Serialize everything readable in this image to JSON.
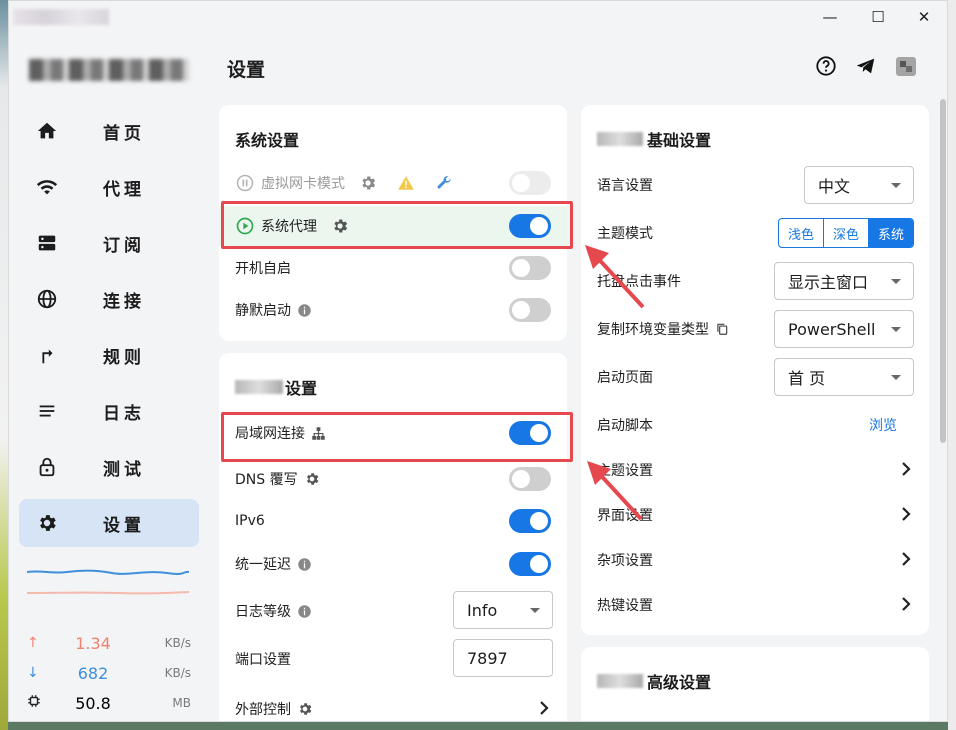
{
  "window": {
    "controls": {
      "minimize": "—",
      "maximize": "☐",
      "close": "✕"
    }
  },
  "sidebar": {
    "items": [
      {
        "label": "首页",
        "icon": "home-icon",
        "active": false
      },
      {
        "label": "代理",
        "icon": "wifi-icon",
        "active": false
      },
      {
        "label": "订阅",
        "icon": "storage-icon",
        "active": false
      },
      {
        "label": "连接",
        "icon": "globe-icon",
        "active": false
      },
      {
        "label": "规则",
        "icon": "route-icon",
        "active": false
      },
      {
        "label": "日志",
        "icon": "list-icon",
        "active": false
      },
      {
        "label": "测试",
        "icon": "lock-icon",
        "active": false
      },
      {
        "label": "设置",
        "icon": "gear-icon",
        "active": true
      }
    ],
    "stats": {
      "upload": {
        "arrow": "↑",
        "value": "1.34",
        "unit": "KB/s",
        "color": "#f0826f"
      },
      "download": {
        "arrow": "↓",
        "value": "682",
        "unit": "KB/s",
        "color": "#3f8fdc"
      },
      "memory": {
        "value": "50.8",
        "unit": "MB"
      }
    }
  },
  "header": {
    "title": "设置",
    "icons": [
      "help-icon",
      "telegram-icon",
      "github-icon"
    ]
  },
  "system_card": {
    "title": "系统设置",
    "rows": [
      {
        "label": "虚拟网卡模式",
        "toggle": "disabled"
      },
      {
        "label": "系统代理",
        "toggle": "on"
      },
      {
        "label": "开机自启",
        "toggle": "off"
      },
      {
        "label": "静默启动",
        "toggle": "off"
      }
    ]
  },
  "clash_card": {
    "title_suffix": "设置",
    "rows": [
      {
        "label": "局域网连接",
        "toggle": "on"
      },
      {
        "label": "DNS 覆写",
        "toggle": "off"
      },
      {
        "label": "IPv6",
        "toggle": "on"
      },
      {
        "label": "统一延迟",
        "toggle": "on"
      },
      {
        "label": "日志等级",
        "select": "Info"
      },
      {
        "label": "端口设置",
        "input": "7897"
      },
      {
        "label": "外部控制"
      }
    ]
  },
  "basic_card": {
    "title_suffix": "基础设置",
    "rows": [
      {
        "label": "语言设置",
        "select": "中文"
      },
      {
        "label": "主题模式",
        "segments": [
          "浅色",
          "深色",
          "系统"
        ],
        "selected": "系统"
      },
      {
        "label": "托盘点击事件",
        "select": "显示主窗口"
      },
      {
        "label": "复制环境变量类型",
        "select": "PowerShell"
      },
      {
        "label": "启动页面",
        "select": "首 页"
      },
      {
        "label": "启动脚本",
        "link": "浏览"
      },
      {
        "label": "主题设置"
      },
      {
        "label": "界面设置"
      },
      {
        "label": "杂项设置"
      },
      {
        "label": "热键设置"
      }
    ]
  },
  "advanced_card": {
    "title_suffix": "高级设置"
  },
  "colors": {
    "accent": "#1677e5",
    "highlight": "#e5484d",
    "active_nav": "#d6e4f5",
    "green": "#2fa84f"
  }
}
